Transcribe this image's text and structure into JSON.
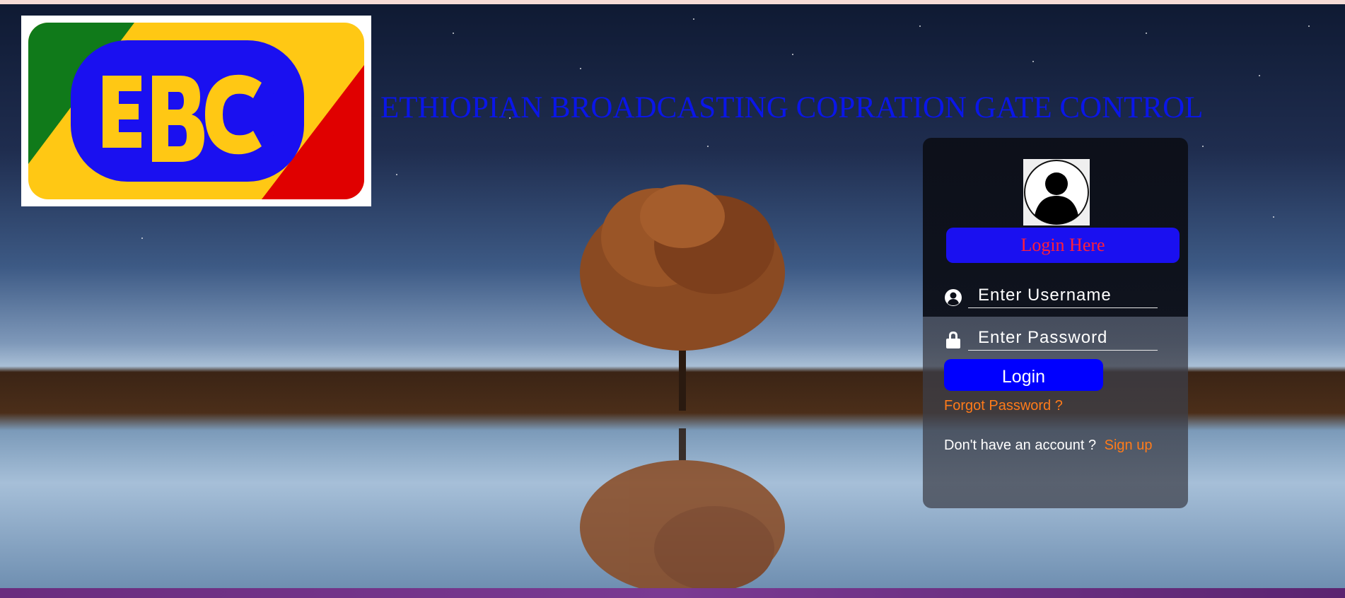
{
  "page": {
    "title": "ETHIOPIAN BROADCASTING COPRATION GATE CONTROL"
  },
  "logo": {
    "text": "EBC",
    "colors": {
      "green": "#107a1a",
      "yellow": "#ffc814",
      "red": "#e00000",
      "blue": "#1a10f0"
    }
  },
  "login": {
    "heading": "Login Here",
    "avatar_icon": "user-avatar-icon",
    "username_placeholder": "Enter Username",
    "username_icon": "user-circle-icon",
    "password_placeholder": "Enter Password",
    "password_icon": "lock-icon",
    "button_label": "Login",
    "forgot_label": "Forgot Password ?",
    "no_account_text": "Don't have an account ?",
    "signup_label": "Sign up"
  },
  "colors": {
    "title": "#0a16e8",
    "heading_bg": "#1a10f0",
    "heading_text": "#ff1f3a",
    "button_bg": "#0000ff",
    "link": "#ff7b1a"
  }
}
